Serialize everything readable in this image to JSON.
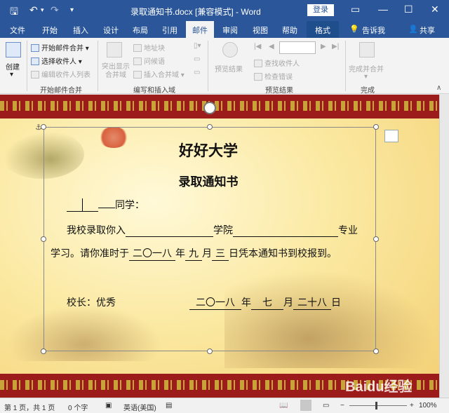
{
  "titlebar": {
    "save_icon": "save-icon",
    "undo_icon": "undo-icon",
    "redo_icon": "redo-icon",
    "customize_icon": "customize-quick-access-icon",
    "title": "录取通知书.docx [兼容模式] - Word",
    "login": "登录",
    "restore_icon": "ribbon-display-options-icon",
    "min_icon": "minimize-icon",
    "max_icon": "maximize-icon",
    "close_icon": "close-icon",
    "glyphs": {
      "save": "🖫",
      "undo": "↶",
      "undo_drop": "▾",
      "redo": "↷",
      "customize": "▾",
      "ribbon": "▭",
      "min": "—",
      "max": "☐",
      "close": "✕"
    }
  },
  "tabs": [
    {
      "label": "文件"
    },
    {
      "label": "开始"
    },
    {
      "label": "插入"
    },
    {
      "label": "设计"
    },
    {
      "label": "布局"
    },
    {
      "label": "引用"
    },
    {
      "label": "邮件"
    },
    {
      "label": "审阅"
    },
    {
      "label": "视图"
    },
    {
      "label": "帮助"
    },
    {
      "label": "格式"
    }
  ],
  "tell_me": "告诉我",
  "share": "共享",
  "ribbon": {
    "create": "创建",
    "start_merge": "开始邮件合并",
    "select_recipients": "选择收件人",
    "edit_recipients": "编辑收件人列表",
    "highlight_fields": "突出显示合并域",
    "address_block": "地址块",
    "greeting_line": "问候语",
    "insert_merge_field": "插入合并域",
    "preview_results": "预览结果",
    "find_recipient": "查找收件人",
    "check_errors": "检查错误",
    "finish_merge": "完成并合并",
    "groups": {
      "start_merge": "开始邮件合并",
      "write_insert": "编写和插入域",
      "preview": "预览结果",
      "finish": "完成"
    },
    "glyphs": {
      "drop": "▾",
      "first": "|◀",
      "prev": "◀",
      "next": "▶",
      "last": "▶|"
    }
  },
  "document": {
    "heading": "好好大学",
    "subheading": "录取通知书",
    "line1_suffix": "同学：",
    "line2_prefix": "我校录取你入",
    "line2_mid": "学院",
    "line2_suffix": "专业",
    "line3_prefix": "学习。请你准时于",
    "year": "二〇一八",
    "year_unit": "年",
    "month": "九",
    "month_unit": "月",
    "day": "三",
    "line3_suffix": "日凭本通知书到校报到。",
    "principal": "校长：优秀",
    "sign_year": "二〇一八",
    "sign_year_unit": "年",
    "sign_month": "七",
    "sign_month_unit": "月",
    "sign_day": "二十八",
    "sign_day_unit": "日"
  },
  "status": {
    "page": "第 1 页，共 1 页",
    "words": "0 个字",
    "proof_icon": "proofing-icon",
    "language": "英语(美国)",
    "macro_icon": "macro-record-icon",
    "zoom_minus": "−",
    "zoom_plus": "+",
    "zoom": "100%",
    "zoom_level": 1.0
  },
  "watermark": "Baidu经验"
}
